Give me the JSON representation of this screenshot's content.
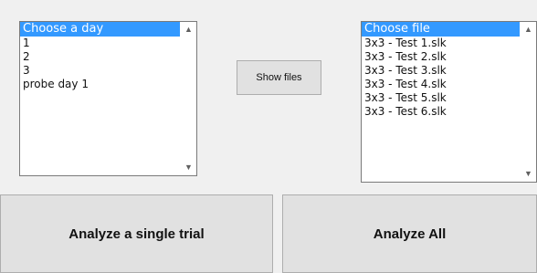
{
  "day_list": {
    "items": [
      "Choose a day",
      "1",
      "2",
      "3",
      "probe day 1"
    ],
    "selected_index": 0
  },
  "show_files_button": {
    "label": "Show files"
  },
  "file_list": {
    "items": [
      "Choose file",
      "3x3 - Test 1.slk",
      "3x3 - Test 2.slk",
      "3x3 - Test 3.slk",
      "3x3 - Test 4.slk",
      "3x3 - Test 5.slk",
      "3x3 - Test 6.slk"
    ],
    "selected_index": 0
  },
  "scrollbar": {
    "up_icon": "chevron-up-icon",
    "down_icon": "chevron-down-icon"
  },
  "analyze_single_button": {
    "label": "Analyze a single trial"
  },
  "analyze_all_button": {
    "label": "Analyze All"
  },
  "colors": {
    "selection": "#3399ff",
    "window_bg": "#f0f0f0",
    "button_bg": "#e1e1e1"
  }
}
